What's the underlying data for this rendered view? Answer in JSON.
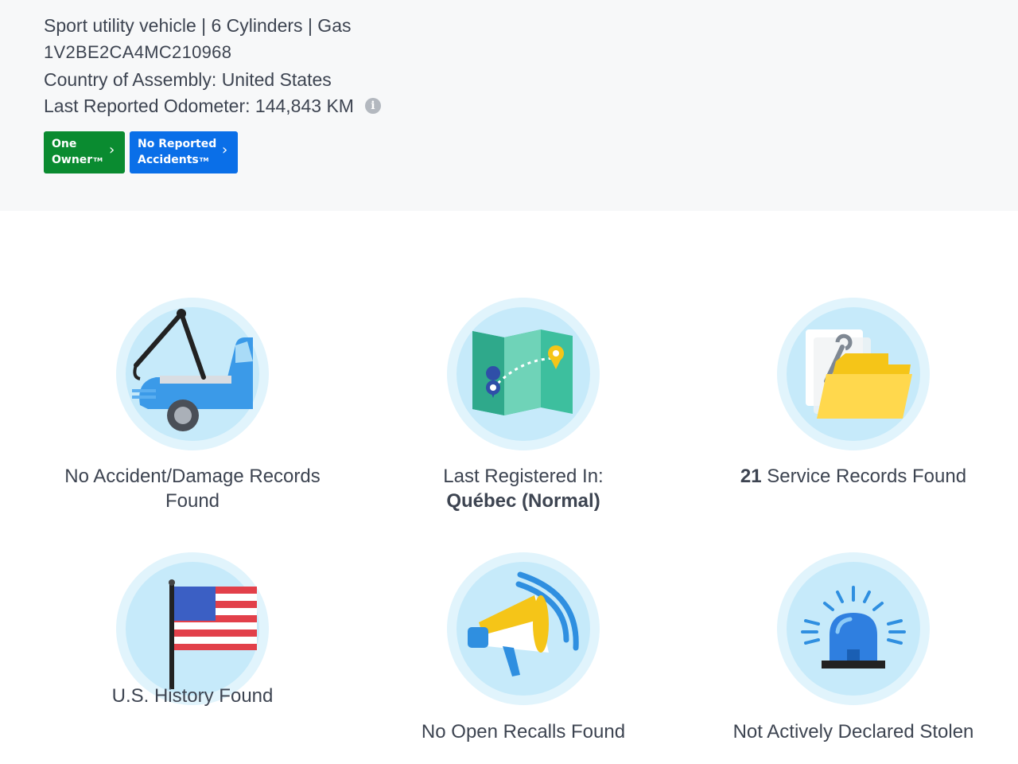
{
  "vehicle": {
    "spec": "Sport utility vehicle | 6 Cylinders | Gas",
    "vin": "1V2BE2CA4MC210968",
    "assembly": "Country of Assembly: United States",
    "odometer": "Last Reported Odometer: 144,843 KM",
    "info_glyph": "i"
  },
  "badges": {
    "owner": {
      "line1": "One",
      "line2": "Owner",
      "tm": "TM",
      "color": "#0a8b30"
    },
    "accidents": {
      "line1": "No Reported",
      "line2": "Accidents",
      "tm": "TM",
      "color": "#0a6fe8"
    }
  },
  "features": {
    "accident": {
      "icon": "tow-truck-icon",
      "line1": "No Accident/Damage Records",
      "line2": "Found"
    },
    "registered": {
      "icon": "map-icon",
      "line1": "Last Registered In:",
      "line2": "Québec (Normal)"
    },
    "service": {
      "icon": "service-folder-icon",
      "count": "21",
      "text": " Service Records Found"
    },
    "history": {
      "icon": "us-flag-icon",
      "line1": "U.S. History Found"
    },
    "recalls": {
      "icon": "megaphone-icon",
      "line1": "No Open Recalls Found"
    },
    "stolen": {
      "icon": "siren-icon",
      "line1": "Not Actively Declared Stolen"
    }
  },
  "colors": {
    "header_bg": "#f7f8f9",
    "circle_outer": "#e1f4fc",
    "circle_inner": "#c6eafa",
    "text": "#3d4451"
  }
}
